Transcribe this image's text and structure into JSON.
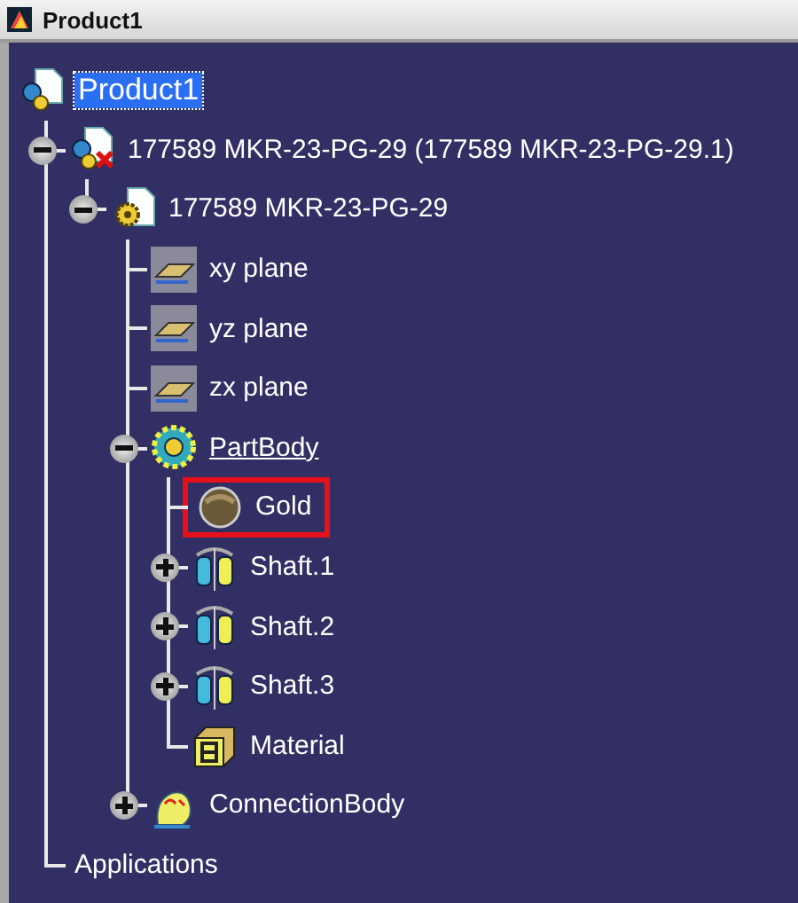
{
  "window": {
    "title": "Product1"
  },
  "tree": [
    {
      "label": "Product1",
      "kind": "product",
      "selected": true,
      "in_work": false,
      "outlined": false,
      "children": [
        {
          "label": "177589 MKR-23-PG-29 (177589 MKR-23-PG-29.1)",
          "kind": "component",
          "selected": false,
          "in_work": false,
          "outlined": false,
          "expanded": true,
          "children": [
            {
              "label": "177589 MKR-23-PG-29",
              "kind": "part",
              "selected": false,
              "in_work": false,
              "outlined": false,
              "expanded": true,
              "children": [
                {
                  "label": "xy plane",
                  "kind": "plane",
                  "selected": false,
                  "in_work": false,
                  "outlined": false
                },
                {
                  "label": "yz plane",
                  "kind": "plane",
                  "selected": false,
                  "in_work": false,
                  "outlined": false
                },
                {
                  "label": "zx plane",
                  "kind": "plane",
                  "selected": false,
                  "in_work": false,
                  "outlined": false
                },
                {
                  "label": "PartBody",
                  "kind": "body",
                  "selected": false,
                  "in_work": true,
                  "outlined": false,
                  "expanded": true,
                  "children": [
                    {
                      "label": "Gold",
                      "kind": "material-ball",
                      "selected": false,
                      "in_work": false,
                      "outlined": true
                    },
                    {
                      "label": "Shaft.1",
                      "kind": "shaft",
                      "selected": false,
                      "in_work": false,
                      "outlined": false,
                      "expanded": false
                    },
                    {
                      "label": "Shaft.2",
                      "kind": "shaft",
                      "selected": false,
                      "in_work": false,
                      "outlined": false,
                      "expanded": false
                    },
                    {
                      "label": "Shaft.3",
                      "kind": "shaft",
                      "selected": false,
                      "in_work": false,
                      "outlined": false,
                      "expanded": false
                    },
                    {
                      "label": "Material",
                      "kind": "material",
                      "selected": false,
                      "in_work": false,
                      "outlined": false
                    }
                  ]
                },
                {
                  "label": "ConnectionBody",
                  "kind": "connection",
                  "selected": false,
                  "in_work": false,
                  "outlined": false,
                  "expanded": false
                }
              ]
            }
          ]
        },
        {
          "label": "Applications",
          "kind": "none",
          "selected": false,
          "in_work": false,
          "outlined": false
        }
      ]
    }
  ]
}
